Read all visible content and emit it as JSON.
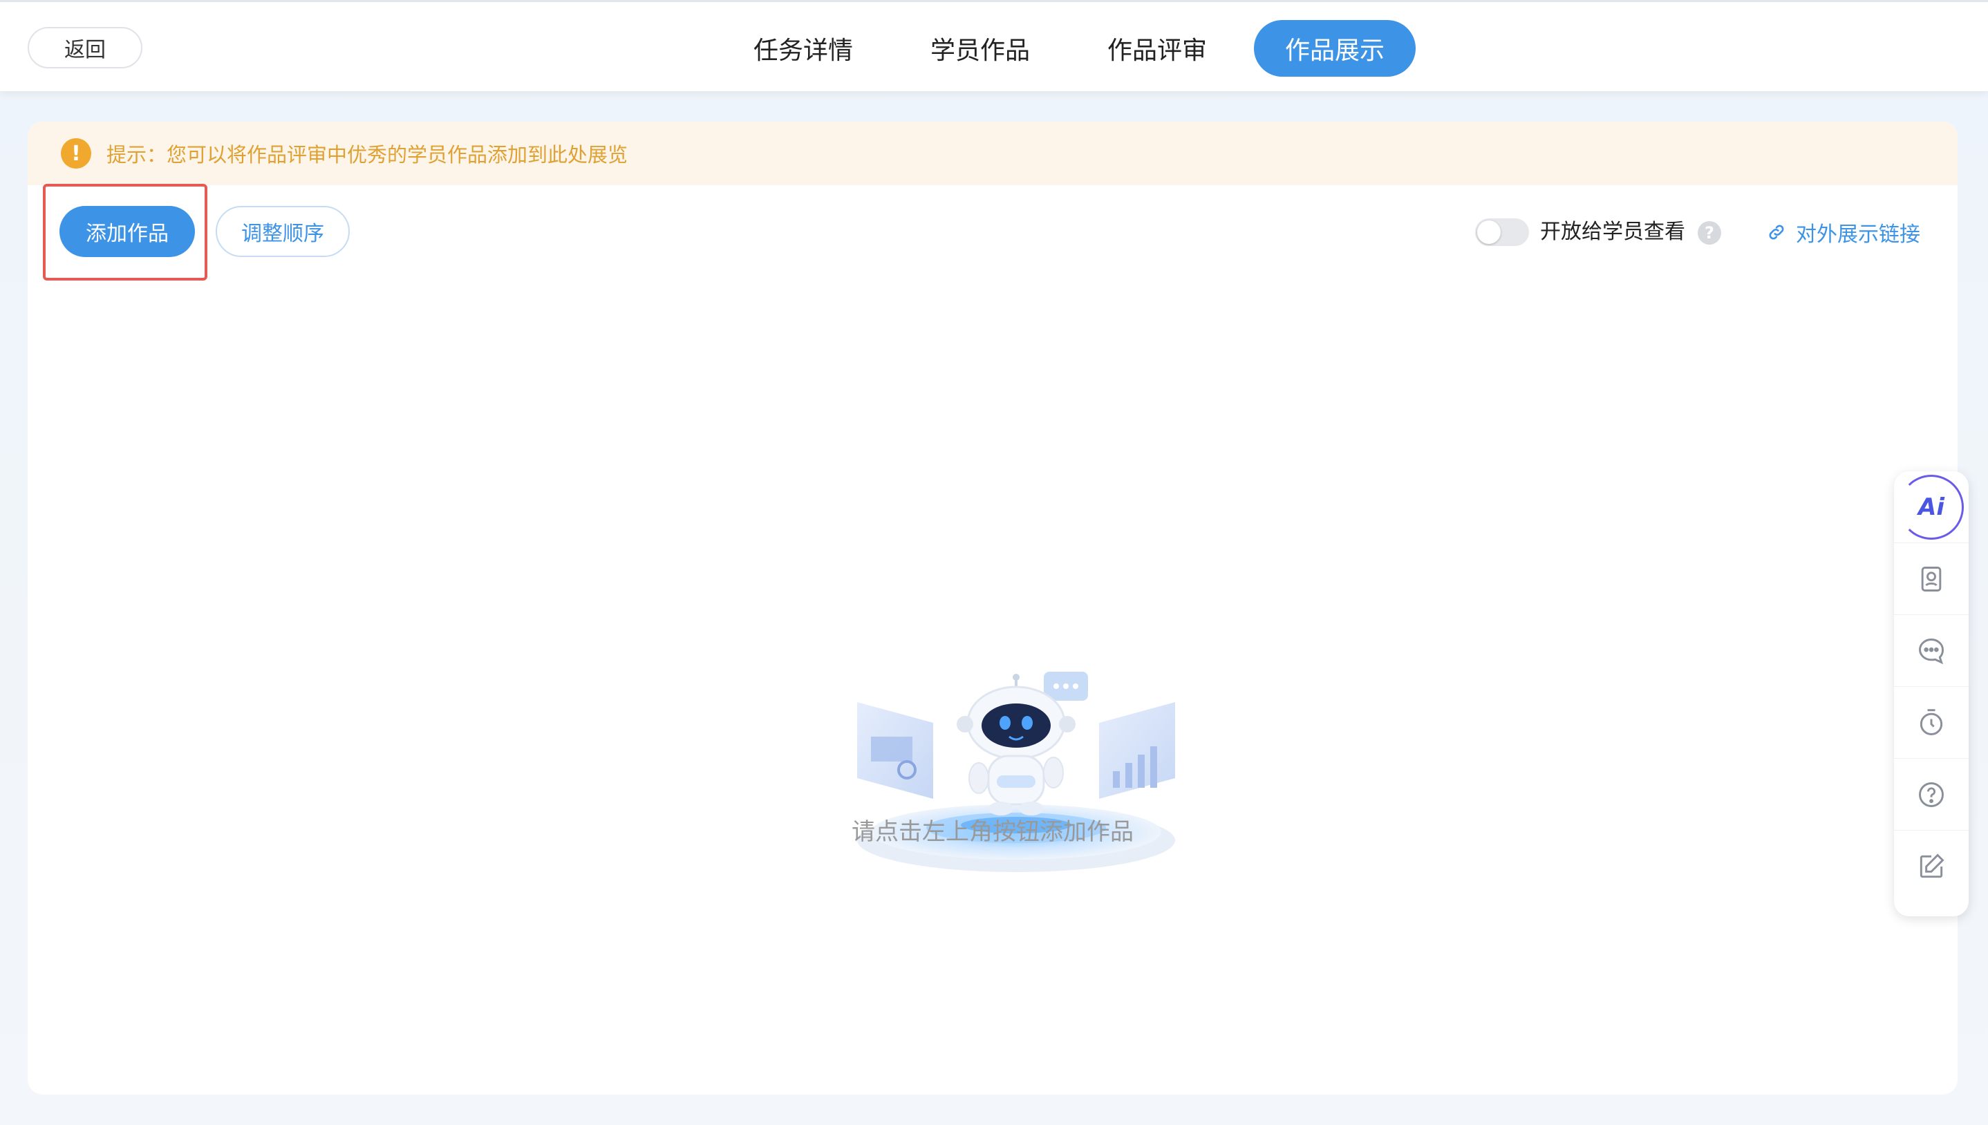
{
  "header": {
    "back_label": "返回",
    "tabs": [
      {
        "label": "任务详情",
        "active": false
      },
      {
        "label": "学员作品",
        "active": false
      },
      {
        "label": "作品评审",
        "active": false
      },
      {
        "label": "作品展示",
        "active": true
      }
    ]
  },
  "notice": {
    "icon": "warning-icon",
    "text": "提示：您可以将作品评审中优秀的学员作品添加到此处展览",
    "color": "#e0a133"
  },
  "toolbar": {
    "add_label": "添加作品",
    "reorder_label": "调整顺序",
    "toggle_label": "开放给学员查看",
    "toggle_on": false,
    "help_glyph": "?",
    "link_label": "对外展示链接"
  },
  "empty": {
    "text": "请点击左上角按钮添加作品"
  },
  "sidepanel": {
    "ai_label": "Ai",
    "items": [
      "ai-assistant-icon",
      "profile-card-icon",
      "chat-icon",
      "timer-icon",
      "help-icon",
      "edit-icon"
    ]
  },
  "colors": {
    "accent": "#3d93e6",
    "highlight": "#e35b54",
    "notice_bg": "#fdf5e9"
  }
}
